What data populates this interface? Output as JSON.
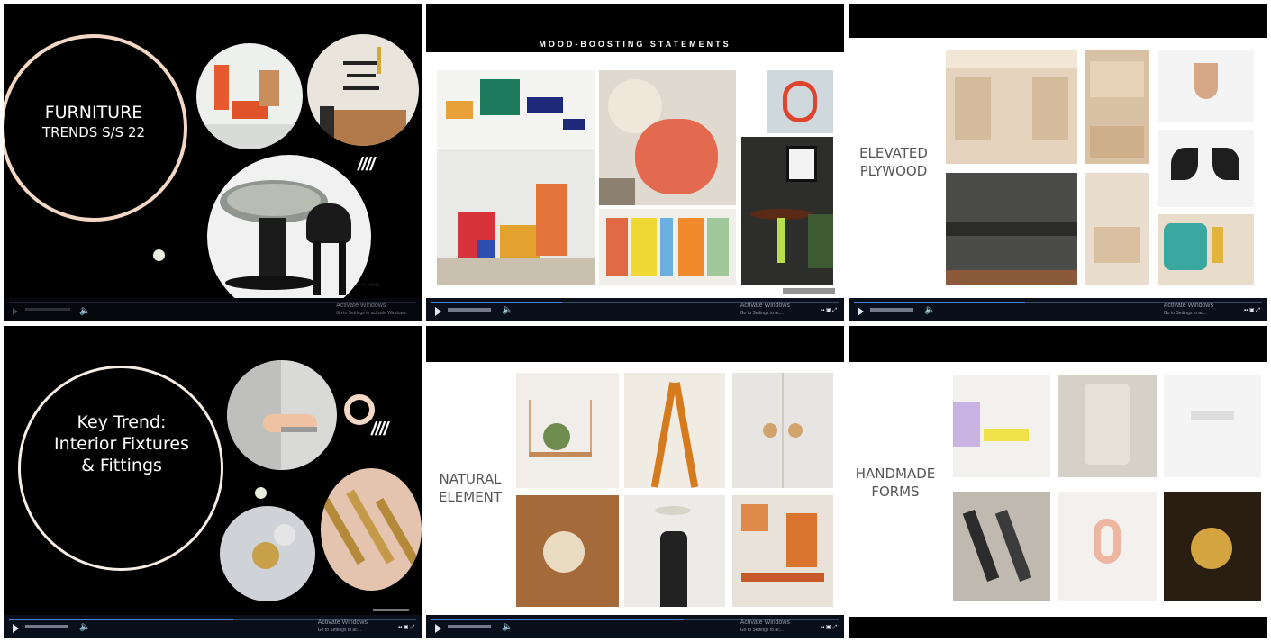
{
  "slides": [
    {
      "title_line1": "FURNITURE",
      "title_line2": "TRENDS S/S 22",
      "slashes": "////",
      "stamp": "▪▪▪▪ ▪▪ ▪▪ ▪▪▪▪▪▪",
      "player": {
        "activate_title": "Activate Windows",
        "activate_sub": "Go to Settings to activate Windows.",
        "progress": 0.0
      }
    },
    {
      "header": "MOOD-BOOSTING STATEMENTS",
      "player": {
        "activate_title": "Activate Windows",
        "activate_sub": "Go to Settings to ac...",
        "progress": 0.32
      }
    },
    {
      "title_line1": "ELEVATED",
      "title_line2": "PLYWOOD",
      "player": {
        "activate_title": "Activate Windows",
        "activate_sub": "Go to Settings to ac...",
        "progress": 0.42
      }
    },
    {
      "title_line1": "Key Trend:",
      "title_line2": "Interior Fixtures",
      "title_line3": "& Fittings",
      "slashes": "////",
      "player": {
        "activate_title": "Activate Windows",
        "activate_sub": "Go to Settings to ac...",
        "progress": 0.55
      }
    },
    {
      "title_line1": "NATURAL",
      "title_line2": "ELEMENT",
      "player": {
        "activate_title": "Activate Windows",
        "activate_sub": "Go to Settings to ac...",
        "progress": 0.62
      }
    },
    {
      "title_line1": "HANDMADE",
      "title_line2": "FORMS"
    }
  ],
  "colors": {
    "ring": "#f3d7c4",
    "player_bg": "#0a0f1c",
    "player_fill": "#4e7fd6"
  }
}
